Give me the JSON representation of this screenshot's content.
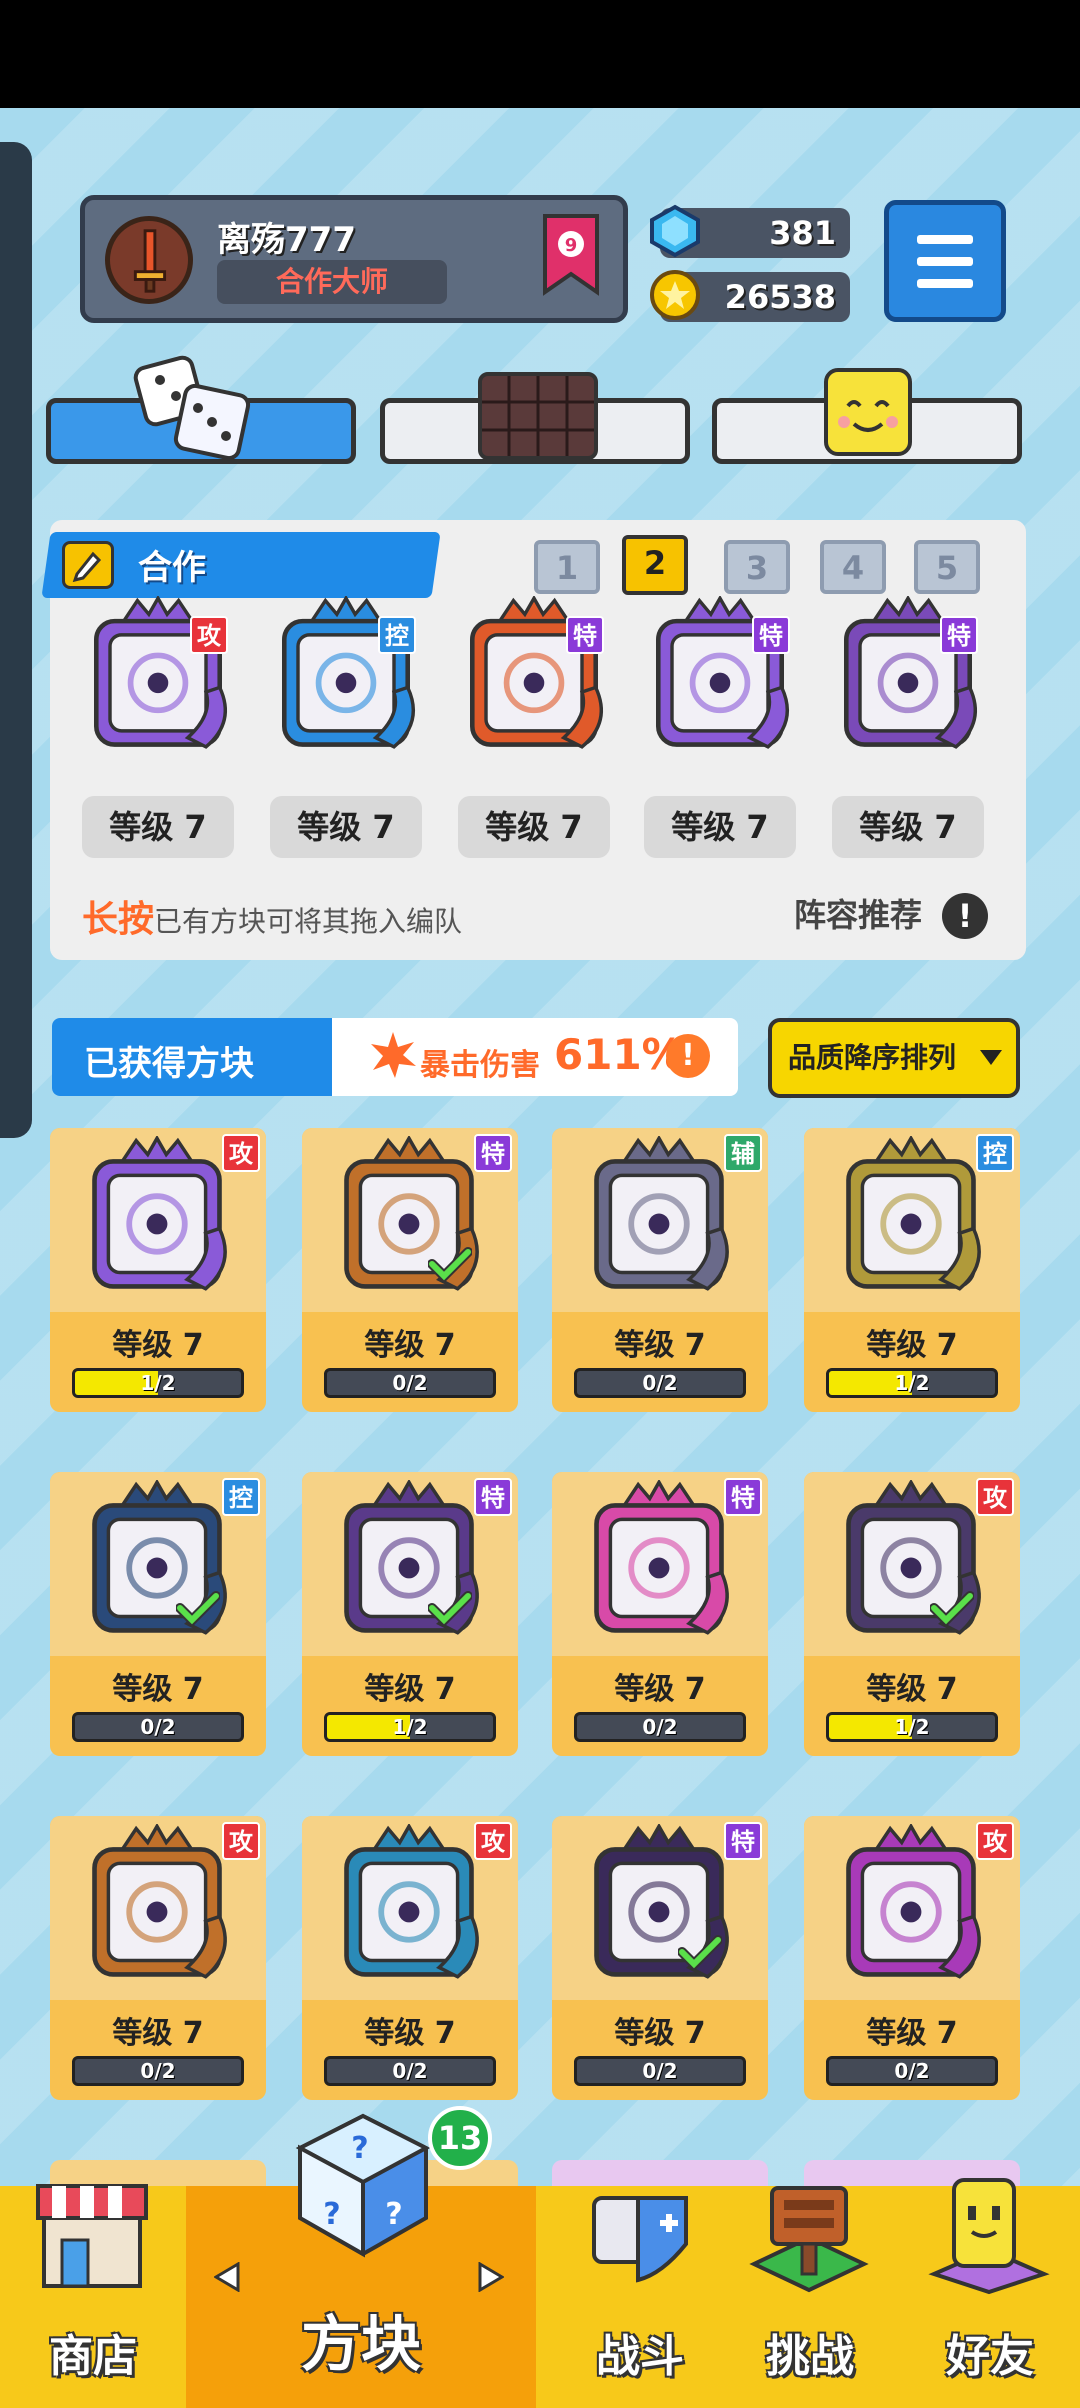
{
  "profile": {
    "name": "离殇777",
    "title": "合作大师",
    "rank": "9"
  },
  "resources": {
    "gems": "381",
    "coins": "26538"
  },
  "mode_tabs": [
    "dice-icon",
    "board-icon",
    "smile-icon"
  ],
  "team": {
    "section_label": "合作",
    "preset_tabs": [
      "1",
      "2",
      "3",
      "4",
      "5"
    ],
    "active_preset": "2",
    "slots": [
      {
        "tag": "攻",
        "level": "等级 7",
        "color": "#8a5ad8"
      },
      {
        "tag": "控",
        "level": "等级 7",
        "color": "#2a8de0"
      },
      {
        "tag": "特",
        "level": "等级 7",
        "color": "#e05a2a"
      },
      {
        "tag": "特",
        "level": "等级 7",
        "color": "#8a5ad8"
      },
      {
        "tag": "特",
        "level": "等级 7",
        "color": "#7a4ab8"
      }
    ],
    "hint_bold": "长按",
    "hint_text": "已有方块可将其拖入编队",
    "recommend": "阵容推荐",
    "excl": "!"
  },
  "owned": {
    "title": "已获得方块",
    "crit_label": "暴击伤害",
    "crit_value": "611%",
    "excl": "!",
    "sort_label": "品质降序排列"
  },
  "cards": [
    {
      "tag": "攻",
      "level": "等级 7",
      "progress": "1/2",
      "fill": 0.5,
      "checked": false,
      "color": "#8a5ad8"
    },
    {
      "tag": "特",
      "level": "等级 7",
      "progress": "0/2",
      "fill": 0,
      "checked": true,
      "color": "#c0702a"
    },
    {
      "tag": "辅",
      "level": "等级 7",
      "progress": "0/2",
      "fill": 0,
      "checked": false,
      "color": "#6a6a8a"
    },
    {
      "tag": "控",
      "level": "等级 7",
      "progress": "1/2",
      "fill": 0.5,
      "checked": false,
      "color": "#b09a3a"
    },
    {
      "tag": "控",
      "level": "等级 7",
      "progress": "0/2",
      "fill": 0,
      "checked": true,
      "color": "#2a4a7a"
    },
    {
      "tag": "特",
      "level": "等级 7",
      "progress": "1/2",
      "fill": 0.5,
      "checked": true,
      "color": "#5a3a8a"
    },
    {
      "tag": "特",
      "level": "等级 7",
      "progress": "0/2",
      "fill": 0,
      "checked": false,
      "color": "#d84aa8"
    },
    {
      "tag": "攻",
      "level": "等级 7",
      "progress": "1/2",
      "fill": 0.5,
      "checked": true,
      "color": "#4a3a6a"
    },
    {
      "tag": "攻",
      "level": "等级 7",
      "progress": "0/2",
      "fill": 0,
      "checked": false,
      "color": "#c0702a"
    },
    {
      "tag": "攻",
      "level": "等级 7",
      "progress": "0/2",
      "fill": 0,
      "checked": false,
      "color": "#2a8ab8"
    },
    {
      "tag": "特",
      "level": "等级 7",
      "progress": "0/2",
      "fill": 0,
      "checked": true,
      "color": "#3a2a5a"
    },
    {
      "tag": "攻",
      "level": "等级 7",
      "progress": "0/2",
      "fill": 0,
      "checked": false,
      "color": "#a83ab8"
    }
  ],
  "nav": {
    "shop": "商店",
    "dice": "方块",
    "dice_badge": "13",
    "battle": "战斗",
    "challenge": "挑战",
    "friends": "好友"
  }
}
